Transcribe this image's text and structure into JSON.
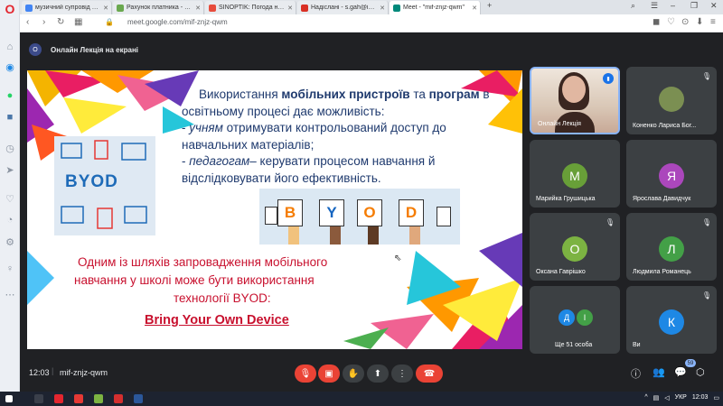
{
  "browser": {
    "tabs": [
      {
        "label": "музичний супровід занят",
        "fav_color": "#4285f4"
      },
      {
        "label": "Рахунок платника - #209",
        "fav_color": "#6aa84f"
      },
      {
        "label": "SINOPTIK: Погода на 17 в",
        "fav_color": "#e74c3c"
      },
      {
        "label": "Надіслані - s.gah@ippo.ed",
        "fav_color": "#d93025"
      },
      {
        "label": "Meet - \"mif-znjz-qwm\"",
        "fav_color": "#00897b",
        "active": true
      }
    ],
    "url": "meet.google.com/mif-znjz-qwm"
  },
  "meet": {
    "present_avatar": "О",
    "present_title": "Онлайн Лекція на екрані",
    "time": "12:03",
    "separator": "|",
    "meeting_code": "mif-znjz-qwm",
    "people_count": "59"
  },
  "slide": {
    "main_lines": [
      {
        "pre": "Використання ",
        "bold1": "мобільних пристроїв",
        "mid": " та ",
        "bold2": "програм",
        "post": " в"
      },
      {
        "text": "освітньому процесі дає можливість:"
      },
      {
        "pre": " - ",
        "italic": "учням",
        "post": " отримувати контрольований доступ до"
      },
      {
        "text": "навчальних матеріалів;"
      },
      {
        "pre": " - ",
        "italic": "педагогам",
        "post": "– керувати процесом навчання й"
      },
      {
        "text": "відслідковувати його ефективність."
      }
    ],
    "byod_logo": "BYOD",
    "byod_letters": [
      "B",
      "Y",
      "O",
      "D"
    ],
    "red_lines": [
      "Одним із шляхів запровадження мобільного",
      "навчання у школі може бути використання",
      "технології BYOD:",
      "Bring Your Own Device"
    ]
  },
  "participants": [
    {
      "name": "Онлайн Лекція",
      "type": "host"
    },
    {
      "name": "Коненко Лариса Бог...",
      "type": "photo"
    },
    {
      "name": "Марийка Грушицька",
      "initial": "М",
      "color": "#689f38"
    },
    {
      "name": "Ярослава Давидчук",
      "initial": "Я",
      "color": "#ab47bc"
    },
    {
      "name": "Оксана Гаврішко",
      "initial": "О",
      "color": "#7cb342"
    },
    {
      "name": "Людмила Романець",
      "initial": "Л",
      "color": "#43a047"
    },
    {
      "name": "Ще 51 особа",
      "type": "more",
      "avatars": [
        {
          "initial": "Д",
          "color": "#1e88e5"
        },
        {
          "initial": "І",
          "color": "#43a047"
        }
      ]
    },
    {
      "name": "Ви",
      "initial": "К",
      "color": "#1e88e5"
    }
  ],
  "taskbar": {
    "lang": "УКР",
    "time": "12:03"
  },
  "colors": {
    "meet_bg": "#202124",
    "tile_bg": "#3c4043",
    "slide_blue": "#1f3a6e",
    "slide_red": "#c8102e",
    "end_call": "#ea4335"
  }
}
